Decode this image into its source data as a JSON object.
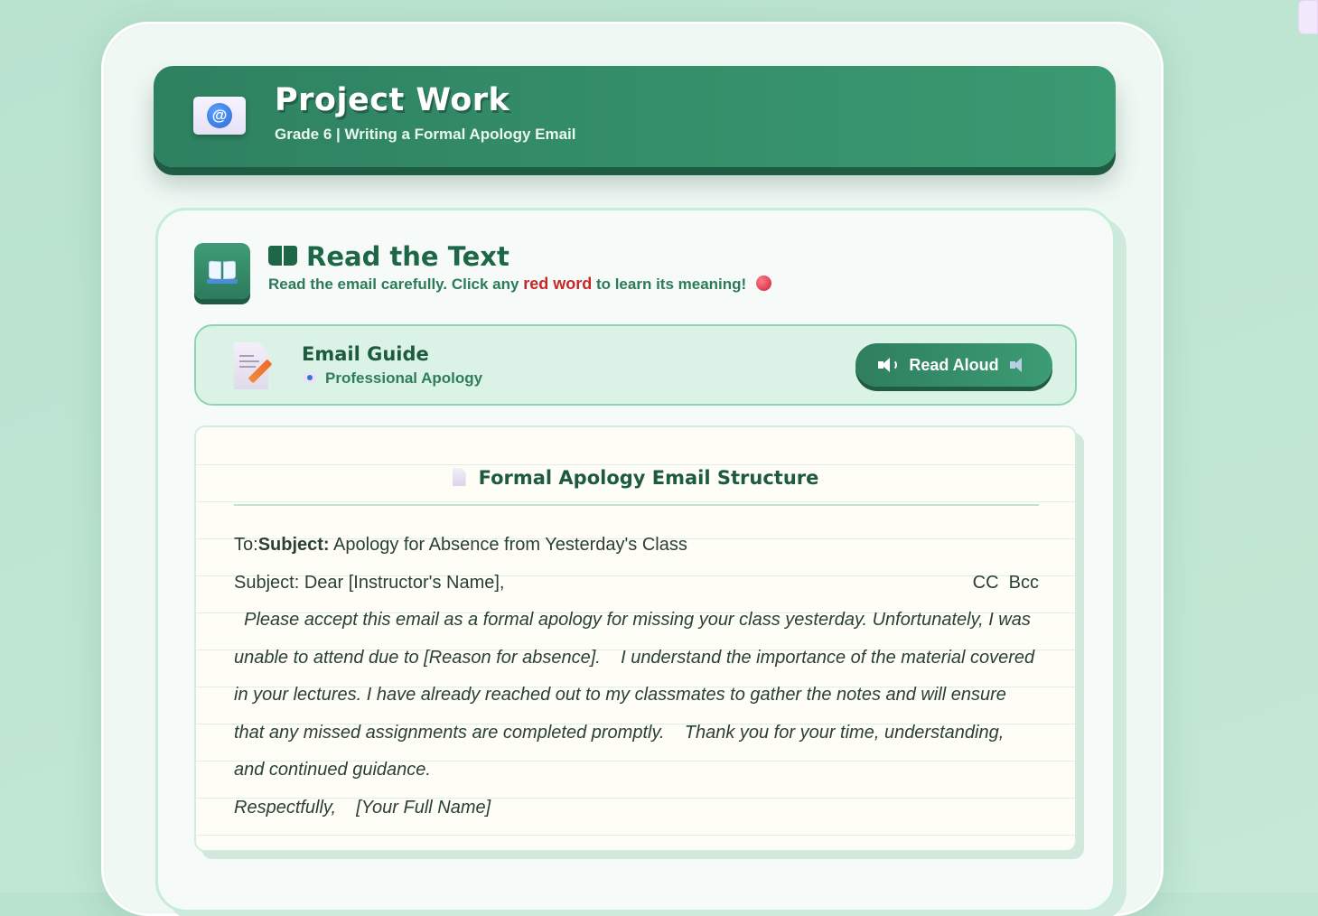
{
  "header": {
    "title": "Project Work",
    "subtitle": "Grade 6  |  Writing a Formal Apology Email",
    "icon": "email-at-icon"
  },
  "section": {
    "title": "Read the Text",
    "desc_before": "Read the email carefully. Click any ",
    "desc_red": "red word",
    "desc_after": " to learn its meaning! ",
    "icon": "book-icon"
  },
  "guide": {
    "title": "Email Guide",
    "subtitle": "Professional Apology",
    "button_label": "Read Aloud",
    "icon": "document-pencil-icon"
  },
  "email": {
    "heading": "Formal Apology Email Structure",
    "to_label": "To:",
    "subject_bold": "Subject:",
    "subject_text": " Apology for Absence from Yesterday's Class",
    "subject_label": "Subject:",
    "greeting": " Dear [Instructor's Name],",
    "cc_label": "CC",
    "bcc_label": "Bcc",
    "body": "  Please accept this email as a formal apology for missing your class yesterday. Unfortunately, I was unable to attend due to [Reason for absence].    I understand the importance of the material covered in your lectures. I have already reached out to my classmates to gather the notes and will ensure that any missed assignments are completed promptly.    Thank you for your time, understanding, and continued guidance.",
    "closing": "Respectfully,    [Your Full Name]"
  },
  "colors": {
    "primary": "#2e8160",
    "accent_red": "#c62828",
    "background": "#bfe6d3"
  }
}
